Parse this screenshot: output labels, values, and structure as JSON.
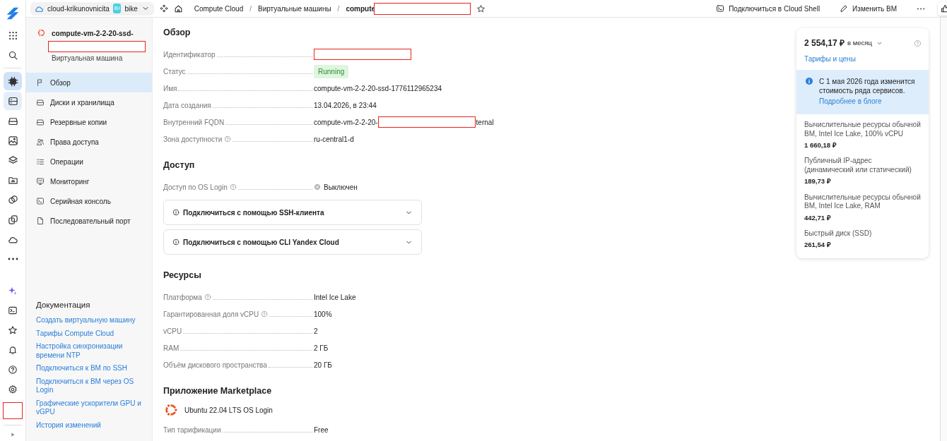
{
  "topbar": {
    "cloud": "cloud-krikunovnicita",
    "folder_badge": "BI",
    "folder": "bike",
    "separator": "/",
    "breadcrumbs": [
      {
        "text": "Compute Cloud"
      },
      {
        "text": "Виртуальные машины"
      },
      {
        "text": "compute",
        "redacted": true
      }
    ],
    "actions": [
      {
        "kind": "shell",
        "label": "Подключиться в Cloud Shell"
      },
      {
        "kind": "edit",
        "label": "Изменить ВМ"
      },
      {
        "kind": "more"
      }
    ]
  },
  "rail": {
    "top": [
      {
        "selected": false,
        "hover": false
      },
      {
        "selected": false,
        "hover": false
      },
      {
        "selected": true,
        "hover": false
      },
      {
        "selected": false,
        "hover": true
      },
      {
        "selected": false,
        "hover": false
      },
      {
        "selected": false,
        "hover": false
      },
      {
        "selected": false,
        "hover": false
      },
      {
        "selected": false,
        "hover": false
      },
      {
        "selected": false,
        "hover": false
      },
      {
        "selected": false,
        "hover": false
      },
      {
        "selected": false,
        "hover": false
      },
      {
        "selected": false,
        "hover": false
      }
    ],
    "bottom": [
      {
        "selected": false,
        "hover": false
      },
      {
        "selected": false,
        "hover": false
      },
      {
        "selected": false,
        "hover": false
      },
      {
        "selected": false,
        "hover": false
      },
      {
        "selected": false,
        "hover": false
      },
      {
        "selected": false,
        "hover": false
      }
    ],
    "account_redacted": true
  },
  "sidebar": {
    "title": "compute-vm-2-2-20-ssd-",
    "title_redacted": true,
    "subtitle": "Виртуальная машина",
    "items": [
      {
        "label": "Обзор",
        "selected": true
      },
      {
        "label": "Диски и хранилища",
        "selected": false
      },
      {
        "label": "Резервные копии",
        "selected": false
      },
      {
        "label": "Права доступа",
        "selected": false
      },
      {
        "label": "Операции",
        "selected": false
      },
      {
        "label": "Мониторинг",
        "selected": false
      },
      {
        "label": "Серийная консоль",
        "selected": false
      },
      {
        "label": "Последовательный порт",
        "selected": false
      }
    ],
    "docs": {
      "title": "Документация",
      "links": [
        "Создать виртуальную машину",
        "Тарифы Compute Cloud",
        "Настройка синхронизации времени NTP",
        "Подключиться к ВМ по SSH",
        "Подключиться к ВМ через OS Login",
        "Графические ускорители GPU и vGPU",
        "История изменений"
      ]
    }
  },
  "sections": [
    {
      "title": "Обзор",
      "rows": [
        {
          "label": "Идентификатор",
          "help": false,
          "kind": "redacted"
        },
        {
          "label": "Статус",
          "help": false,
          "kind": "status",
          "value": "Running"
        },
        {
          "label": "Имя",
          "help": false,
          "kind": "text",
          "value": "compute-vm-2-2-20-ssd-1776112965234"
        },
        {
          "label": "Дата создания",
          "help": false,
          "kind": "text",
          "value": "13.04.2026, в 23:44"
        },
        {
          "label": "Внутренний FQDN",
          "help": false,
          "kind": "partly_redacted",
          "value": "compute-vm-2-2-20-",
          "value_end": "ternal"
        },
        {
          "label": "Зона доступности",
          "help": true,
          "kind": "text",
          "value": "ru-central1-d"
        }
      ]
    },
    {
      "title": "Доступ",
      "rows": [
        {
          "label": "Доступ по OS Login",
          "help": true,
          "kind": "off",
          "value": "Выключен"
        }
      ],
      "accordions": [
        {
          "label": "Подключиться с помощью SSH-клиента",
          "expanded": false
        },
        {
          "label": "Подключиться с помощью CLI Yandex Cloud",
          "expanded": false
        }
      ]
    },
    {
      "title": "Ресурсы",
      "rows": [
        {
          "label": "Платформа",
          "help": true,
          "kind": "text",
          "value": "Intel Ice Lake"
        },
        {
          "label": "Гарантированная доля vCPU",
          "help": true,
          "kind": "text",
          "value": "100%"
        },
        {
          "label": "vCPU",
          "help": false,
          "kind": "text",
          "value": "2"
        },
        {
          "label": "RAM",
          "help": false,
          "kind": "text",
          "value": "2 ГБ"
        },
        {
          "label": "Объём дискового пространства",
          "help": false,
          "kind": "text",
          "value": "20 ГБ"
        }
      ]
    },
    {
      "title": "Приложение Marketplace",
      "app": "Ubuntu 22.04 LTS OS Login",
      "rows": [
        {
          "label": "Тип тарификации",
          "help": false,
          "kind": "text",
          "value": "Free"
        }
      ]
    }
  ],
  "price": {
    "total": "2 554,17 ₽",
    "period": "в месяц",
    "link": "Тарифы и цены",
    "notice": {
      "text": "С 1 мая 2026 года изменится стоимость ряда сервисов.",
      "link": "Подробнее в блоге"
    },
    "items": [
      {
        "name": "Вычислительные ресурсы обычной ВМ, Intel Ice Lake, 100% vCPU",
        "price": "1 660,18 ₽"
      },
      {
        "name": "Публичный IP-адрес (динамический или статический)",
        "price": "189,73 ₽"
      },
      {
        "name": "Вычислительные ресурсы обычной ВМ, Intel Ice Lake, RAM",
        "price": "442,71 ₽"
      },
      {
        "name": "Быстрый диск (SSD)",
        "price": "261,54 ₽"
      }
    ]
  }
}
